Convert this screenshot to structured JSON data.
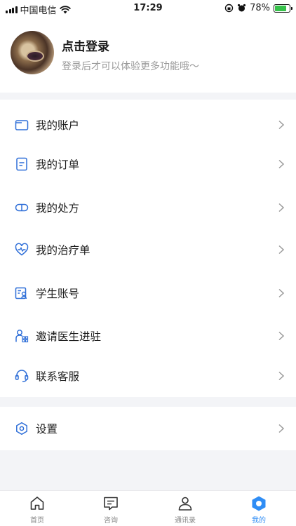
{
  "status": {
    "carrier": "中国电信",
    "time": "17:29",
    "battery": "78%",
    "battery_level": 0.78
  },
  "profile": {
    "title": "点击登录",
    "subtitle": "登录后才可以体验更多功能哦～"
  },
  "menu": [
    {
      "label": "我的账户",
      "icon": "wallet-icon"
    },
    {
      "label": "我的订单",
      "icon": "order-icon"
    },
    {
      "label": "我的处方",
      "icon": "pill-icon"
    },
    {
      "label": "我的治疗单",
      "icon": "heart-pulse-icon"
    },
    {
      "label": "学生账号",
      "icon": "student-card-icon"
    },
    {
      "label": "邀请医生进驻",
      "icon": "invite-doctor-icon"
    },
    {
      "label": "联系客服",
      "icon": "headset-icon"
    }
  ],
  "settings": {
    "label": "设置",
    "icon": "settings-icon"
  },
  "tabs": [
    {
      "label": "首页",
      "icon": "home-icon"
    },
    {
      "label": "咨询",
      "icon": "message-icon"
    },
    {
      "label": "通讯录",
      "icon": "contacts-icon"
    },
    {
      "label": "我的",
      "icon": "profile-icon"
    }
  ],
  "colors": {
    "accent": "#2f8df5",
    "icon_blue": "#2f6fd8",
    "background": "#f3f4f7"
  }
}
